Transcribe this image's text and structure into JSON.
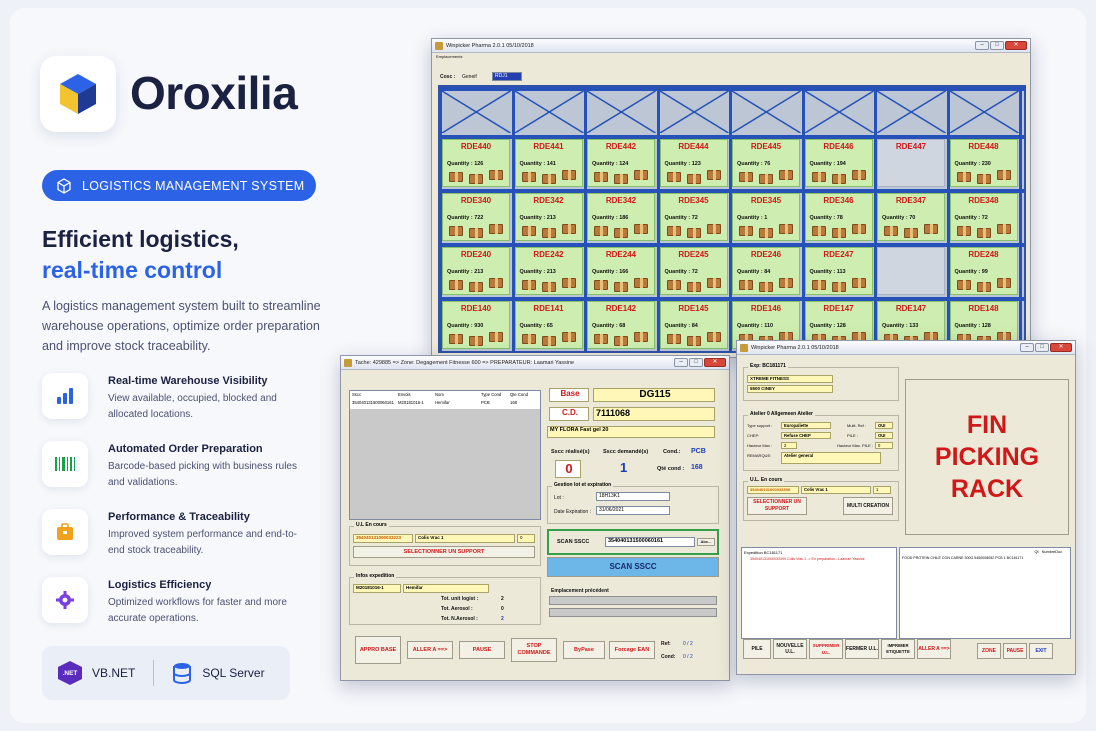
{
  "brand": {
    "name": "Oroxilia",
    "badge": "LOGISTICS MANAGEMENT SYSTEM"
  },
  "headline": {
    "line1": "Efficient logistics,",
    "line2": "real-time control"
  },
  "intro": "A logistics management system built to streamline warehouse operations, optimize order preparation and improve stock traceability.",
  "features": [
    {
      "title": "Real-time Warehouse Visibility",
      "desc": "View available, occupied, blocked and allocated locations.",
      "icon": "bar-chart-icon"
    },
    {
      "title": "Automated Order Preparation",
      "desc": "Barcode-based picking with business rules and validations.",
      "icon": "barcode-icon"
    },
    {
      "title": "Performance & Traceability",
      "desc": "Improved system performance and end-to-end stock traceability.",
      "icon": "briefcase-icon"
    },
    {
      "title": "Logistics Efficiency",
      "desc": "Optimized workflows for faster and more accurate operations.",
      "icon": "gear-icon"
    }
  ],
  "tech": {
    "net_badge": ".NET",
    "net_label": "VB.NET",
    "sql_label": "SQL Server"
  },
  "rack_window": {
    "title": "Winpicker Pharma 2.0.1 05/10/2018",
    "subtitle": "Emplacements",
    "cosc_label": "Cosc :",
    "cosc_label2": "Geneif",
    "cosc_value": "RDJ1",
    "rows": [
      [
        {
          "name": "RDE440",
          "qty": "Quantity : 126"
        },
        {
          "name": "RDE441",
          "qty": "Quantity : 141"
        },
        {
          "name": "RDE442",
          "qty": "Quantity : 124"
        },
        {
          "name": "RDE444",
          "qty": "Quantity : 123"
        },
        {
          "name": "RDE445",
          "qty": "Quantity : 76"
        },
        {
          "name": "RDE446",
          "qty": "Quantity : 194"
        },
        {
          "name": "RDE447",
          "qty": ""
        },
        {
          "name": "RDE448",
          "qty": "Quantity : 230"
        }
      ],
      [
        {
          "name": "RDE340",
          "qty": "Quantity : 722"
        },
        {
          "name": "RDE342",
          "qty": "Quantity : 213"
        },
        {
          "name": "RDE342",
          "qty": "Quantity : 186"
        },
        {
          "name": "RDE345",
          "qty": "Quantity : 72"
        },
        {
          "name": "RDE345",
          "qty": "Quantity : 1"
        },
        {
          "name": "RDE346",
          "qty": "Quantity : 78"
        },
        {
          "name": "RDE347",
          "qty": "Quantity : 70"
        },
        {
          "name": "RDE348",
          "qty": "Quantity : 72"
        }
      ],
      [
        {
          "name": "RDE240",
          "qty": "Quantity : 213"
        },
        {
          "name": "RDE242",
          "qty": "Quantity : 213"
        },
        {
          "name": "RDE244",
          "qty": "Quantity : 166"
        },
        {
          "name": "RDE245",
          "qty": "Quantity : 72"
        },
        {
          "name": "RDE246",
          "qty": "Quantity : 84"
        },
        {
          "name": "RDE247",
          "qty": "Quantity : 113"
        },
        {
          "name": "",
          "qty": ""
        },
        {
          "name": "RDE248",
          "qty": "Quantity : 99"
        }
      ],
      [
        {
          "name": "RDE140",
          "qty": "Quantity : 930"
        },
        {
          "name": "RDE141",
          "qty": "Quantity : 65"
        },
        {
          "name": "RDE142",
          "qty": "Quantity : 68"
        },
        {
          "name": "RDE145",
          "qty": "Quantity : 84"
        },
        {
          "name": "RDE146",
          "qty": "Quantity : 110"
        },
        {
          "name": "RDE147",
          "qty": "Quantity : 128"
        },
        {
          "name": "RDE147",
          "qty": "Quantity : 133"
        },
        {
          "name": "RDE148",
          "qty": "Quantity : 128"
        }
      ]
    ]
  },
  "picking_window": {
    "title": "Tache: 429885 => Zone: Degagement Fitnesse 600 => PREPARATEUR: Laamari Yassine",
    "table_headers": [
      "Sscc",
      "Envois",
      "Nom",
      "Type Cond",
      "Qte Cond"
    ],
    "table_row": [
      "354040131500060161",
      "M20181016-1",
      "Hemifar",
      "PCB",
      "168"
    ],
    "base_label": "Base",
    "base_value": "DG115",
    "cd_label": "C.D.",
    "cd_value": "7111068",
    "product": "MY FLORA Fast gel 20",
    "sscc_realised_label": "Sscc réalisé(s)",
    "sscc_realised": "0",
    "sscc_demanded_label": "Sscc demandé(s)",
    "sscc_demanded": "1",
    "cond_label": "Cond.:",
    "cond_value": "PCB",
    "qte_cond_label": "Qté cond :",
    "qte_cond_value": "168",
    "lot_group": "Gestion lot et expiration",
    "lot_label": "Lot :",
    "lot_value": "18H13K1",
    "exp_label": "Date Expiration :",
    "exp_value": "31/06/2021",
    "ul_group": "U.L En cours",
    "ul_code": "354040131000033223",
    "ul_desc": "Colis Vrac 1",
    "ul_qty": "0",
    "select_support": "SELECTIONNER UN SUPPORT",
    "scan_label": "SCAN SSCC",
    "scan_value": "354040131500060161",
    "abc": "Abc...",
    "scan_button": "SCAN SSCC",
    "emplacement_label": "Emplacement précédent",
    "expedition_group": "Infos expedition",
    "exp_code": "M20181016-1",
    "exp_name": "Hemifar",
    "tot_unit_label": "Tot. unit logist :",
    "tot_unit": "2",
    "tot_aerosol_label": "Tot. Aerosol :",
    "tot_aerosol": "0",
    "tot_naerosol_label": "Tot. N.Aerosol :",
    "tot_naerosol": "2",
    "buttons": [
      "APPRO BASE",
      "ALLER A ==>",
      "PAUSE",
      "STOP COMMANDE",
      "ByPase",
      "Forcage EAN"
    ],
    "ref_label": "Ref:",
    "ref_value": "0 / 2",
    "cond2_label": "Cond:",
    "cond2_value": "0 / 2"
  },
  "fin_window": {
    "title": "Winpicker Pharma 2.0.1 05/10/2018",
    "exp_group": "Exp: BC181171",
    "client": "XTREME FITNESS",
    "city": "5500 CINEY",
    "atelier_group": "Atelier 0 Allgemeen Atelier",
    "type_support_label": "Type support :",
    "type_support": "Europaliette",
    "chep_label": "CHEP:",
    "chep": "Refuse CHEP",
    "hauteur_label": "Hauteur Max :",
    "hauteur": "2",
    "remarque_label": "REMARQUE:",
    "remarque": "Atelier general",
    "multi_ref_label": "Multi. Ref :",
    "multi_ref": "OUI",
    "pile_label": "PILE :",
    "pile": "OUI",
    "hauteur_pile_label": "Hauteur Max. PILE :",
    "hauteur_pile": "0",
    "ul_group": "U.L. En cours",
    "ul_code": "354040131000033399",
    "ul_desc": "Colis Vrac 1",
    "ul_qty": "1",
    "select_support": "SELECTIONNER UN SUPPORT",
    "multi_creation": "MULTI CREATION",
    "fin_text": "FIN PICKING RACK",
    "tree_root": "Expedition BC181171",
    "tree_child": "354040131000033399 Colis Vrac 1 -> En preparation - Laamari Yassine",
    "list_headers": [
      "Qt",
      "NumbreDoc"
    ],
    "list_row": "FOOD PROTEIN CHILE CON CARNE 300G    5450008052 PCB   1   BC181171",
    "buttons": [
      "PILE",
      "NOUVELLE U.L.",
      "SUPPRIMER U.L.",
      "FERMER U.L.",
      "IMPRIMER ETIQUETTE",
      "ALLER A ==>",
      "ZONE",
      "PAUSE",
      "EXIT"
    ]
  },
  "colors": {
    "accent": "#2c63e6",
    "dark": "#1b2140",
    "rack_blue": "#2551b8",
    "loc_green": "#cdeeb0",
    "red": "#d01818"
  }
}
